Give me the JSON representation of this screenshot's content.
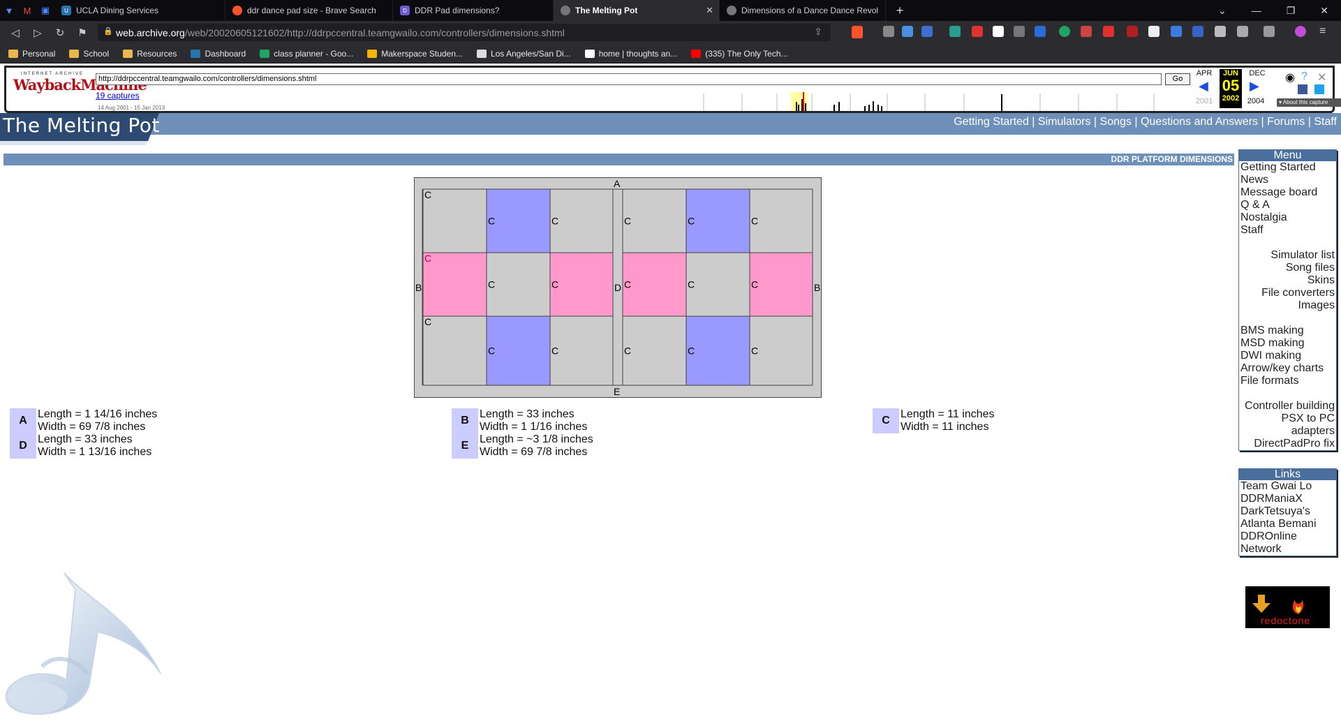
{
  "browser": {
    "tabs": [
      {
        "title": "UCLA Dining Services",
        "favicon": "ucla-icon",
        "active": false
      },
      {
        "title": "ddr dance pad size - Brave Search",
        "favicon": "brave-icon",
        "active": false
      },
      {
        "title": "DDR Pad dimensions?",
        "favicon": "forum-icon",
        "active": false
      },
      {
        "title": "The Melting Pot",
        "favicon": "globe-icon",
        "active": true
      },
      {
        "title": "Dimensions of a Dance Dance Revoluti",
        "favicon": "globe-icon",
        "active": false
      }
    ],
    "url_host": "web.archive.org",
    "url_path": "/web/20020605121602/http://ddrpccentral.teamgwailo.com/controllers/dimensions.shtml",
    "bookmarks": [
      "Personal",
      "School",
      "Resources",
      "Dashboard",
      "class planner - Goo...",
      "Makerspace Studen...",
      "Los Angeles/San Di...",
      "home | thoughts an...",
      "(335) The Only Tech..."
    ]
  },
  "wayback": {
    "logo_small": "INTERNET ARCHIVE",
    "logo_big": "WaybackMachine",
    "url": "http://ddrpccentral.teamgwailo.com/controllers/dimensions.shtml",
    "go_label": "Go",
    "captures": "19 captures",
    "date_range": "14 Aug 2001 - 15 Jan 2013",
    "prev_month": "APR",
    "cur_month": "JUN",
    "next_month": "DEC",
    "day": "05",
    "prev_year": "2001",
    "cur_year": "2002",
    "next_year": "2004",
    "about": "About this capture"
  },
  "site": {
    "title": "The Melting Pot",
    "nav": [
      "Getting Started",
      "Simulators",
      "Songs",
      "Questions and Answers",
      "Forums",
      "Staff"
    ],
    "banner": "DDR PLATFORM DIMENSIONS"
  },
  "pad": {
    "label_a": "A",
    "label_b": "B",
    "label_c": "C",
    "label_d": "D",
    "label_e": "E",
    "color_frame": "#cccccc",
    "color_blue": "#9999ff",
    "color_pink": "#ff99cc"
  },
  "dimensions": [
    {
      "letter": "A",
      "length": "Length = 1 14/16 inches",
      "width": "Width = 69 7/8 inches"
    },
    {
      "letter": "D",
      "length": "Length = 33 inches",
      "width": "Width = 1 13/16 inches"
    },
    {
      "letter": "B",
      "length": "Length = 33 inches",
      "width": "Width = 1 1/16 inches"
    },
    {
      "letter": "E",
      "length": "Length = ~3 1/8 inches",
      "width": "Width = 69 7/8 inches"
    },
    {
      "letter": "C",
      "length": "Length = 11 inches",
      "width": "Width = 11 inches"
    }
  ],
  "menu": {
    "title": "Menu",
    "group1": [
      "Getting Started",
      "News",
      "Message board",
      "Q & A",
      "Nostalgia",
      "Staff"
    ],
    "group2": [
      "Simulator list",
      "Song files",
      "Skins",
      "File converters",
      "Images"
    ],
    "group3": [
      "BMS making",
      "MSD making",
      "DWI making",
      "Arrow/key charts",
      "File formats"
    ],
    "group4": [
      "Controller building",
      "PSX to PC",
      "adapters",
      "DirectPadPro fix"
    ]
  },
  "links": {
    "title": "Links",
    "items": [
      "Team Gwai Lo",
      "DDRManiaX",
      "DarkTetsuya's",
      "Atlanta Bemani",
      "DDROnline",
      "Network"
    ]
  },
  "sponsor": {
    "name": "redoctone"
  }
}
